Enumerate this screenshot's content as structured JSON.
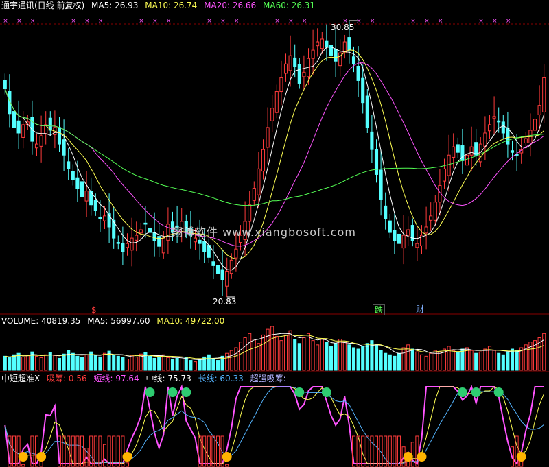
{
  "colors": {
    "up": "#ff3b3b",
    "down": "#54ffff",
    "ma5": "#ffffff",
    "ma10": "#ffff54",
    "ma20": "#ff54ff",
    "ma60": "#54ff54",
    "grid": "#8a0000",
    "text": "#ffffff",
    "watermark": "#c8c8c8",
    "vol_ma5": "#ffffff",
    "vol_ma10": "#ffff54",
    "short_line": "#ff54ff",
    "mid_line": "#ffff54",
    "long_line": "#54b4ff",
    "absorb": "#ff3b3b",
    "strong_absorb": "#b4b4ff"
  },
  "header": {
    "title": "通宇通讯(日线 前复权)",
    "ma5_label": "MA5: 26.93",
    "ma10_label": "MA10: 26.74",
    "ma20_label": "MA20: 26.66",
    "ma60_label": "MA60: 26.31"
  },
  "price_panel": {
    "watermark": "翔博软件 www.xiangbosoft.com",
    "high_label": "30.85",
    "low_label": "20.83",
    "marker_s": "$",
    "badge_drop": "跌",
    "badge_finance": "财"
  },
  "volume_panel": {
    "title": "VOLUME: 40819.35",
    "ma5_label": "MA5: 56997.60",
    "ma10_label": "MA10: 49722.00"
  },
  "indicator_panel": {
    "title": "中短超准X",
    "absorb_label": "吸筹: 0.56",
    "short_label": "短线: 97.64",
    "mid_label": "中线: 75.73",
    "long_label": "长线: 60.33",
    "strong_label": "超强吸筹: -"
  },
  "chart_data": {
    "type": "candlestick",
    "title": "通宇通讯(日线 前复权)",
    "ylim": [
      20.0,
      31.5
    ],
    "price_max_label": 30.85,
    "price_min_label": 20.83,
    "closes": [
      28.2,
      27.3,
      26.8,
      26.6,
      26.9,
      27.0,
      26.3,
      26.2,
      26.5,
      26.9,
      26.7,
      26.8,
      26.2,
      25.8,
      25.3,
      24.9,
      24.6,
      24.3,
      24.5,
      24.0,
      23.8,
      23.5,
      23.6,
      23.2,
      22.8,
      22.6,
      22.3,
      22.6,
      22.8,
      22.9,
      23.1,
      23.3,
      23.0,
      22.7,
      22.5,
      22.8,
      23.3,
      23.0,
      23.2,
      23.4,
      23.0,
      22.9,
      22.8,
      22.6,
      22.3,
      22.1,
      21.8,
      21.5,
      21.3,
      21.6,
      22.0,
      22.4,
      22.9,
      23.4,
      24.0,
      24.6,
      25.3,
      26.0,
      26.8,
      27.5,
      28.1,
      28.6,
      29.1,
      29.4,
      29.0,
      28.4,
      28.8,
      29.3,
      29.6,
      29.9,
      30.0,
      29.7,
      29.4,
      29.2,
      29.5,
      29.9,
      29.6,
      29.1,
      28.5,
      27.7,
      26.8,
      26.0,
      25.1,
      24.2,
      23.5,
      23.0,
      22.7,
      22.6,
      22.9,
      23.1,
      22.7,
      22.6,
      22.9,
      23.2,
      23.6,
      24.1,
      24.7,
      25.3,
      25.8,
      26.1,
      25.9,
      25.6,
      25.8,
      26.1,
      25.8,
      26.2,
      26.6,
      26.9,
      27.2,
      27.0,
      26.6,
      26.2,
      25.9,
      25.8,
      26.0,
      26.4,
      26.7,
      27.1,
      27.6,
      28.6
    ],
    "volume": [
      20,
      18,
      22,
      24,
      19,
      21,
      26,
      20,
      18,
      22,
      25,
      21,
      17,
      23,
      28,
      24,
      20,
      18,
      22,
      26,
      21,
      19,
      24,
      27,
      22,
      20,
      18,
      16,
      21,
      19,
      23,
      25,
      20,
      17,
      19,
      22,
      18,
      15,
      17,
      16,
      18,
      14,
      12,
      15,
      19,
      22,
      17,
      14,
      20,
      24,
      28,
      32,
      40,
      46,
      52,
      44,
      38,
      50,
      58,
      62,
      48,
      42,
      50,
      56,
      44,
      38,
      46,
      52,
      42,
      36,
      44,
      40,
      34,
      38,
      44,
      40,
      36,
      32,
      30,
      34,
      38,
      42,
      36,
      28,
      24,
      22,
      20,
      24,
      32,
      36,
      30,
      26,
      22,
      20,
      24,
      28,
      26,
      30,
      34,
      28,
      26,
      30,
      32,
      28,
      24,
      26,
      30,
      34,
      28,
      24,
      22,
      26,
      30,
      28,
      32,
      36,
      40,
      42,
      46,
      52
    ],
    "indicator": {
      "absorb_value": 0.56,
      "short_value": 97.64,
      "mid_value": 75.73,
      "long_value": 60.33
    }
  }
}
